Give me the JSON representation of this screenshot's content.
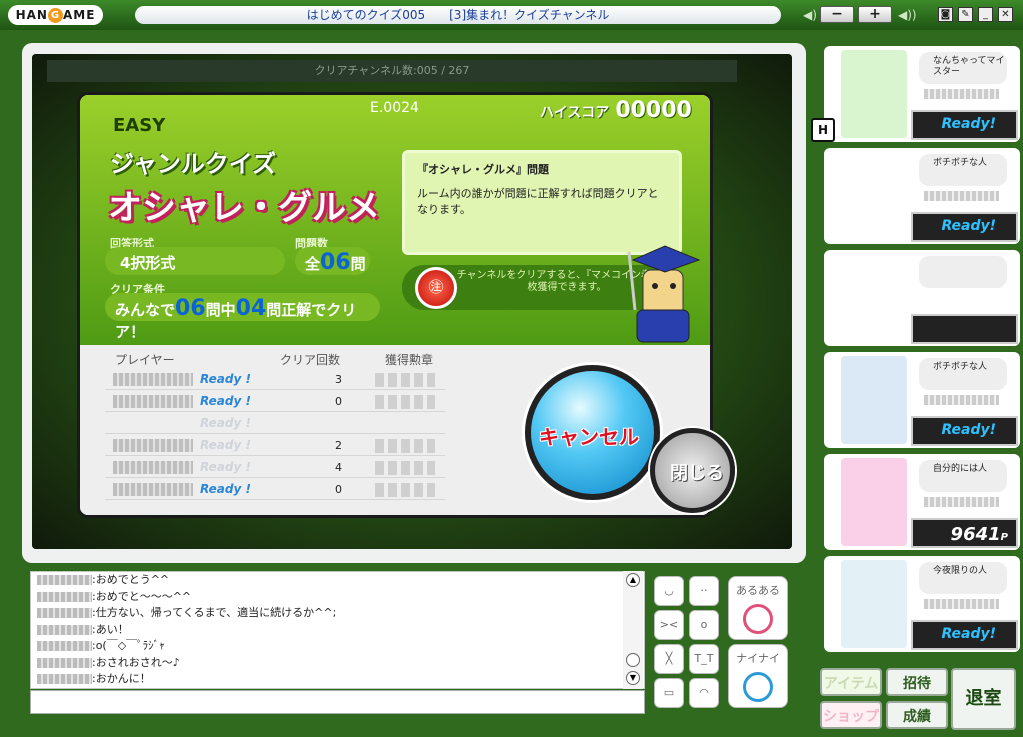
{
  "titlebar": {
    "logo": "HANGAME",
    "title": "はじめてのクイズ005　　[3]集まれ！クイズチャンネル",
    "minus": "−",
    "plus": "+"
  },
  "game": {
    "clear_channels": "クリアチャンネル数:005 / 267",
    "code": "E.0024",
    "hiscore_label": "ハイスコア",
    "hiscore_value": "00000",
    "difficulty": "EASY",
    "genre": "ジャンルクイズ",
    "quiz_name": "オシャレ・グルメ",
    "format_label": "回答形式",
    "format_value": "4択形式",
    "count_label": "問題数",
    "count_prefix": "全",
    "count_value": "06",
    "count_suffix": "問",
    "cond_label": "クリア条件",
    "cond_pre": "みんなで",
    "cond_total": "06",
    "cond_mid": "問中",
    "cond_need": "04",
    "cond_post": "問正解でクリア！",
    "desc_title": "『オシャレ・グルメ』問題",
    "desc_body": "ルーム内の誰かが問題に正解すれば問題クリアとなります。",
    "reward_text": "チャンネルをクリアすると、『マメコイン赤』を1枚獲得できます。",
    "coin": "㊟",
    "col_player": "プレイヤー",
    "col_clear": "クリア回数",
    "col_medal": "獲得勲章",
    "rows": [
      {
        "ready": "Ready !",
        "clears": "3"
      },
      {
        "ready": "Ready !",
        "clears": "0"
      },
      {
        "ready": "Ready !",
        "clears": ""
      },
      {
        "ready": "Ready !",
        "clears": "2"
      },
      {
        "ready": "Ready !",
        "clears": "4"
      },
      {
        "ready": "Ready !",
        "clears": "0"
      }
    ],
    "cancel": "キャンセル",
    "close": "閉じる"
  },
  "chat": {
    "lines": [
      ":おめでとう^^",
      ":おめでと〜〜〜^^",
      ":仕方ない、帰ってくるまで、適当に続けるか^^;",
      ":あい！",
      ":o(￣◇￣ﾟﾗｼﾞｬ",
      ":おされおされ〜♪",
      ":おかんに！"
    ]
  },
  "emotes": {
    "aru": "あるある",
    "nai": "ナイナイ"
  },
  "players": [
    {
      "title": "なんちゃってマイスター",
      "status": "Ready!",
      "color": "#d9f5d0"
    },
    {
      "title": "ボチボチな人",
      "status": "Ready!",
      "color": "#ffffff"
    },
    {
      "title": "",
      "status": "",
      "color": "#ffffff"
    },
    {
      "title": "ボチボチな人",
      "status": "Ready!",
      "color": "#dbe9f7"
    },
    {
      "title": "自分的には人",
      "status": "9641",
      "color": "#f9d0e8"
    },
    {
      "title": "今夜限りの人",
      "status": "Ready!",
      "color": "#e3f1f7"
    }
  ],
  "host_mark": "H",
  "points_unit": "P",
  "buttons": {
    "item": "アイテム",
    "shop": "ショップ",
    "invite": "招待",
    "record": "成績",
    "exit": "退室"
  }
}
